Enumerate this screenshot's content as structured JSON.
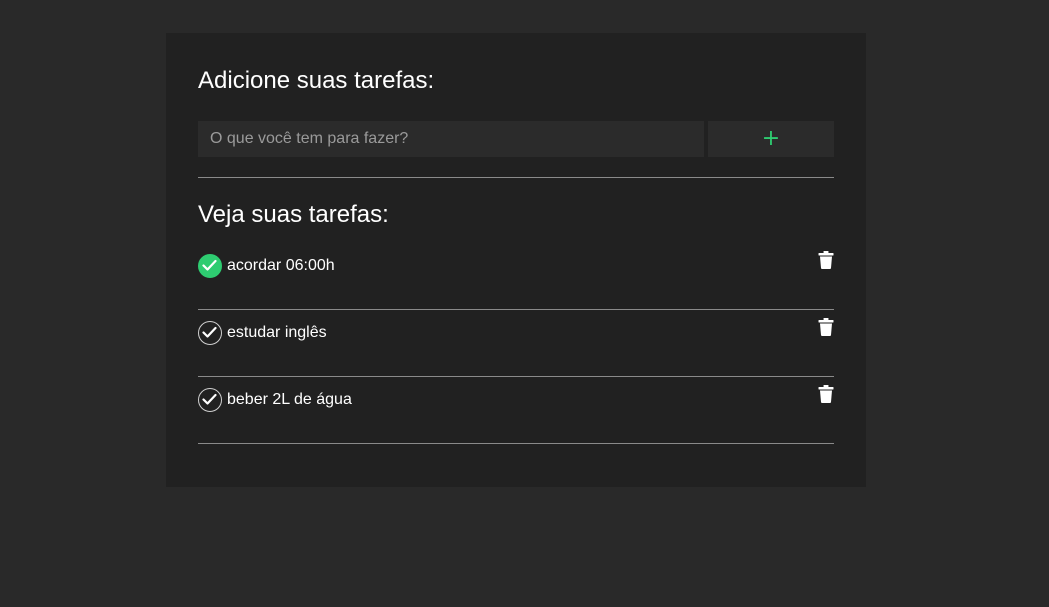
{
  "add_section": {
    "title": "Adicione suas tarefas:",
    "input_placeholder": "O que você tem para fazer?",
    "input_value": "",
    "add_button_label": "+"
  },
  "list_section": {
    "title": "Veja suas tarefas:"
  },
  "tasks": [
    {
      "text": "acordar 06:00h",
      "done": true
    },
    {
      "text": "estudar inglês",
      "done": false
    },
    {
      "text": "beber 2L de água",
      "done": false
    }
  ],
  "colors": {
    "page_background": "#292929",
    "card_background": "#212121",
    "input_background": "#2b2b2b",
    "accent_green": "#2ecc71",
    "divider": "#8a8a8a"
  },
  "icons": {
    "check": "check-icon",
    "delete": "trash-icon",
    "add": "plus-icon"
  }
}
